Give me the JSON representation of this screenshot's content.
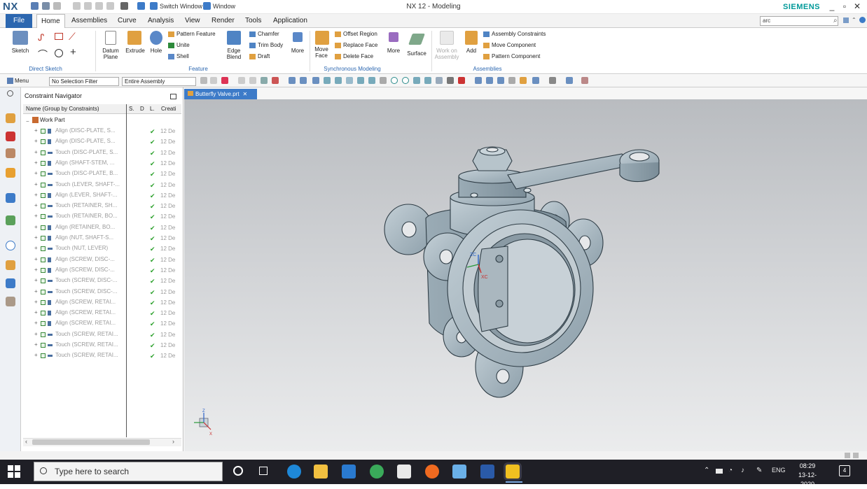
{
  "titlebar": {
    "logo": "NX",
    "title": "NX 12 - Modeling",
    "brand": "SIEMENS",
    "switch_window": "Switch Window",
    "window_menu": "Window",
    "minimize": "_",
    "restore": "▫",
    "close": "✕"
  },
  "menu": {
    "file": "File",
    "tabs": [
      "Home",
      "Assemblies",
      "Curve",
      "Analysis",
      "View",
      "Render",
      "Tools",
      "Application"
    ],
    "search_value": "arc"
  },
  "ribbon": {
    "direct_sketch": {
      "sketch": "Sketch",
      "group": "Direct Sketch"
    },
    "feature": {
      "datum_plane": "Datum Plane",
      "extrude": "Extrude",
      "hole": "Hole",
      "pattern_feature": "Pattern Feature",
      "unite": "Unite",
      "shell": "Shell",
      "edge_blend": "Edge Blend",
      "chamfer": "Chamfer",
      "trim_body": "Trim Body",
      "draft": "Draft",
      "more": "More",
      "group": "Feature"
    },
    "sync": {
      "move_face": "Move Face",
      "offset_region": "Offset Region",
      "replace_face": "Replace Face",
      "delete_face": "Delete Face",
      "more": "More",
      "surface": "Surface",
      "group": "Synchronous Modeling"
    },
    "assemblies": {
      "work_on_assembly": "Work on Assembly",
      "add": "Add",
      "assembly_constraints": "Assembly Constraints",
      "move_component": "Move Component",
      "pattern_component": "Pattern Component",
      "group": "Assemblies"
    }
  },
  "cmdbar": {
    "menu": "Menu",
    "selection_filter": "No Selection Filter",
    "assembly_scope": "Entire Assembly"
  },
  "nav": {
    "title": "Constraint Navigator",
    "columns": [
      "Name (Group by Constraints)",
      "S.",
      "D",
      "L.",
      "Creati"
    ],
    "root": "Work Part",
    "rows": [
      {
        "label": "Align (DISC-PLATE, S...",
        "type": "align",
        "date": "12 De"
      },
      {
        "label": "Align (DISC-PLATE, S...",
        "type": "align",
        "date": "12 De"
      },
      {
        "label": "Touch (DISC-PLATE, S...",
        "type": "touch",
        "date": "12 De"
      },
      {
        "label": "Align (SHAFT-STEM, ...",
        "type": "align",
        "date": "12 De"
      },
      {
        "label": "Touch (DISC-PLATE, B...",
        "type": "touch",
        "date": "12 De"
      },
      {
        "label": "Touch (LEVER, SHAFT-...",
        "type": "touch",
        "date": "12 De"
      },
      {
        "label": "Align (LEVER, SHAFT-...",
        "type": "align",
        "date": "12 De"
      },
      {
        "label": "Touch (RETAINER, SH...",
        "type": "touch",
        "date": "12 De"
      },
      {
        "label": "Touch (RETAINER, BO...",
        "type": "touch",
        "date": "12 De"
      },
      {
        "label": "Align (RETAINER, BO...",
        "type": "align",
        "date": "12 De"
      },
      {
        "label": "Align (NUT, SHAFT-S...",
        "type": "align",
        "date": "12 De"
      },
      {
        "label": "Touch (NUT, LEVER)",
        "type": "touch",
        "date": "12 De"
      },
      {
        "label": "Align (SCREW, DISC-...",
        "type": "align",
        "date": "12 De"
      },
      {
        "label": "Align (SCREW, DISC-...",
        "type": "align",
        "date": "12 De"
      },
      {
        "label": "Touch (SCREW, DISC-...",
        "type": "touch",
        "date": "12 De"
      },
      {
        "label": "Touch (SCREW, DISC-...",
        "type": "touch",
        "date": "12 De"
      },
      {
        "label": "Align (SCREW, RETAI...",
        "type": "align",
        "date": "12 De"
      },
      {
        "label": "Align (SCREW, RETAI...",
        "type": "align",
        "date": "12 De"
      },
      {
        "label": "Align (SCREW, RETAI...",
        "type": "align",
        "date": "12 De"
      },
      {
        "label": "Touch (SCREW, RETAI...",
        "type": "touch",
        "date": "12 De"
      },
      {
        "label": "Touch (SCREW, RETAI...",
        "type": "touch",
        "date": "12 De"
      },
      {
        "label": "Touch (SCREW, RETAI...",
        "type": "touch",
        "date": "12 De"
      }
    ]
  },
  "viewport": {
    "tab_label": "Butterfly Valve.prt",
    "triad_labels": {
      "z": "Z",
      "x": "X",
      "zc": "ZC",
      "xc": "XC"
    }
  },
  "taskbar": {
    "search_placeholder": "Type here to search",
    "language": "ENG",
    "time": "08:29",
    "date": "13-12-2020",
    "notifications": "4"
  },
  "colors": {
    "accent": "#2c67b0",
    "model": "#a9b8c1",
    "check": "#2aa02a",
    "brand": "#009999"
  }
}
